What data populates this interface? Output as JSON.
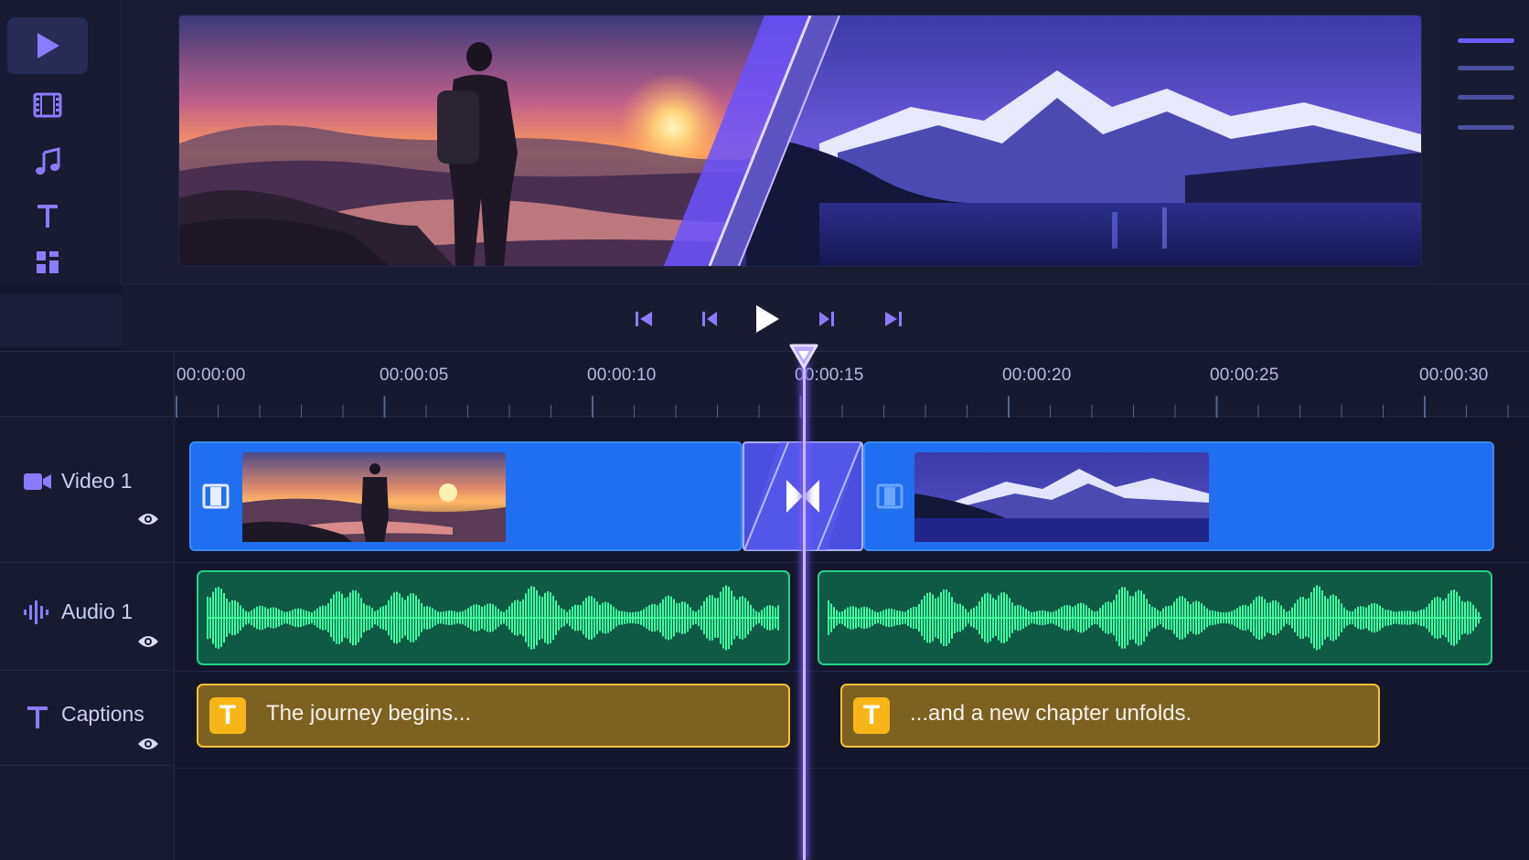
{
  "toolbar": {
    "tools": [
      {
        "icon": "play-icon",
        "active": true
      },
      {
        "icon": "film-icon",
        "active": false
      },
      {
        "icon": "music-icon",
        "active": false
      },
      {
        "icon": "text-icon",
        "active": false
      },
      {
        "icon": "layout-icon",
        "active": false
      }
    ]
  },
  "preview": {
    "left_scene": "sunset-hiker-scene",
    "right_scene": "snow-mountain-lake-scene",
    "transition": "diagonal-wipe"
  },
  "transport": {
    "buttons": [
      "skip-to-start-icon",
      "previous-frame-icon",
      "play-icon",
      "next-frame-icon",
      "skip-to-end-icon"
    ]
  },
  "ruler": {
    "labels": [
      "00:00:00",
      "00:00:05",
      "00:00:10",
      "00:00:15",
      "00:00:20",
      "00:00:25",
      "00:00:30"
    ]
  },
  "playhead": {
    "time_seconds": 15
  },
  "tracks": {
    "video": {
      "name": "Video 1",
      "icon": "video-camera-icon"
    },
    "audio": {
      "name": "Audio 1",
      "icon": "audio-wave-icon"
    },
    "captions": {
      "name": "Captions",
      "icon": "text-icon"
    }
  },
  "clips": {
    "captions": [
      {
        "badge": "T",
        "text": "The journey begins..."
      },
      {
        "badge": "T",
        "text": "...and a new chapter unfolds."
      }
    ]
  },
  "colors": {
    "accent": "#7b5cff",
    "video_clip": "#1f6ff0",
    "audio_clip": "#23d386",
    "caption_clip": "#f3c13a",
    "background": "#14172b"
  }
}
